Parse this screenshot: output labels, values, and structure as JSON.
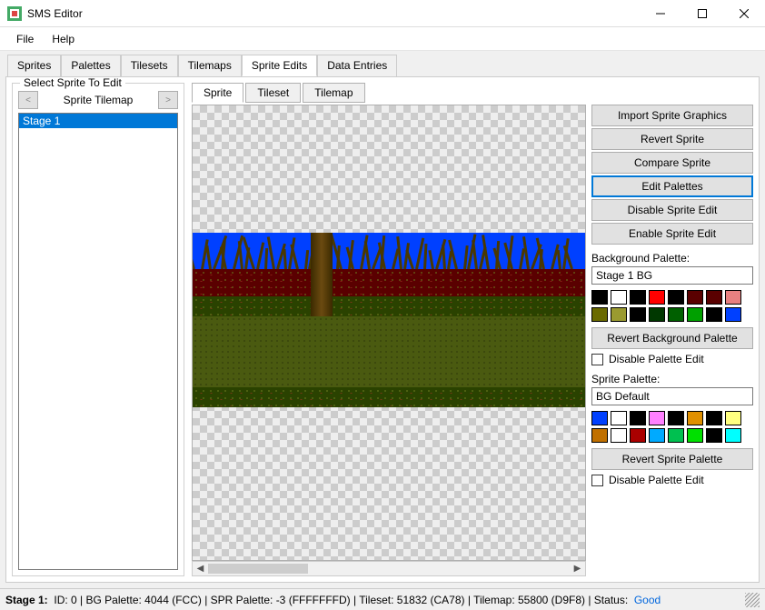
{
  "window": {
    "title": "SMS Editor"
  },
  "menu": {
    "file": "File",
    "help": "Help"
  },
  "main_tabs": [
    "Sprites",
    "Palettes",
    "Tilesets",
    "Tilemaps",
    "Sprite Edits",
    "Data Entries"
  ],
  "main_tab_active": 4,
  "select_group": {
    "title": "Select Sprite To Edit",
    "nav_title": "Sprite Tilemap"
  },
  "sprite_list": [
    "Stage 1"
  ],
  "sprite_selected_index": 0,
  "sub_tabs": [
    "Sprite",
    "Tileset",
    "Tilemap"
  ],
  "sub_tab_active": 0,
  "buttons": {
    "import": "Import Sprite Graphics",
    "revert": "Revert Sprite",
    "compare": "Compare Sprite",
    "edit_palettes": "Edit Palettes",
    "disable_edit": "Disable Sprite Edit",
    "enable_edit": "Enable Sprite Edit",
    "revert_bg": "Revert Background Palette",
    "revert_spr": "Revert Sprite Palette"
  },
  "bg_palette": {
    "label": "Background Palette:",
    "name": "Stage 1 BG",
    "colors": [
      "#000000",
      "#ffffff",
      "#000000",
      "#ff0000",
      "#000000",
      "#5a0000",
      "#5a0000",
      "#e88080",
      "#6a6a00",
      "#9a9a30",
      "#000000",
      "#003800",
      "#006000",
      "#00a000",
      "#000000",
      "#0040ff"
    ],
    "disable_label": "Disable Palette Edit"
  },
  "spr_palette": {
    "label": "Sprite Palette:",
    "name": "BG Default",
    "colors": [
      "#0040ff",
      "#ffffff",
      "#000000",
      "#ff80ff",
      "#000000",
      "#e09000",
      "#000000",
      "#ffff80",
      "#c07000",
      "#ffffff",
      "#aa0000",
      "#00aaff",
      "#00c050",
      "#00e000",
      "#000000",
      "#00ffff"
    ],
    "disable_label": "Disable Palette Edit"
  },
  "status": {
    "prefix": "Stage 1:",
    "body": "ID: 0 | BG Palette: 4044 (FCC) | SPR Palette: -3 (FFFFFFFD) | Tileset: 51832 (CA78) | Tilemap: 55800 (D9F8) | Status:",
    "status_value": "Good"
  }
}
